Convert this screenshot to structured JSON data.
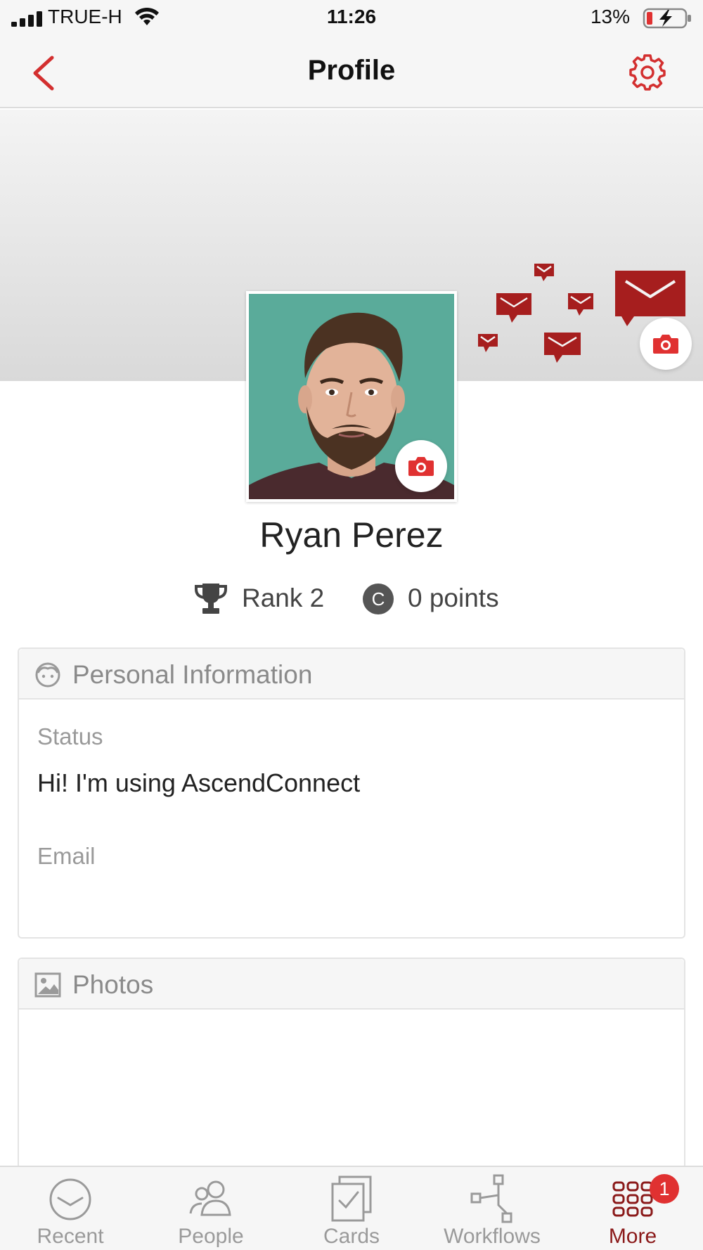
{
  "status_bar": {
    "carrier": "TRUE-H",
    "time": "11:26",
    "battery_percent": "13%",
    "icons": [
      "signal-icon",
      "wifi-icon",
      "battery-charging-icon"
    ]
  },
  "nav": {
    "title": "Profile",
    "back_icon": "chevron-left-icon",
    "settings_icon": "gear-icon"
  },
  "profile": {
    "name": "Ryan Perez",
    "rank_label": "Rank 2",
    "coin_letter": "C",
    "points_label": "0 points"
  },
  "personal_info": {
    "title": "Personal Information",
    "icon": "face-icon",
    "status_label": "Status",
    "status_value": "Hi! I'm using AscendConnect",
    "email_label": "Email",
    "email_value": ""
  },
  "photos": {
    "title": "Photos",
    "icon": "image-icon"
  },
  "tabs": [
    {
      "label": "Recent",
      "icon": "clock-icon",
      "active": false
    },
    {
      "label": "People",
      "icon": "people-icon",
      "active": false
    },
    {
      "label": "Cards",
      "icon": "cards-icon",
      "active": false
    },
    {
      "label": "Workflows",
      "icon": "workflow-icon",
      "active": false
    },
    {
      "label": "More",
      "icon": "grid-icon",
      "active": true,
      "badge": "1"
    }
  ],
  "colors": {
    "accent": "#d32f2f",
    "active_tab": "#8b1a1a",
    "avatar_bg": "#5aab9a",
    "badge": "#e03131"
  }
}
